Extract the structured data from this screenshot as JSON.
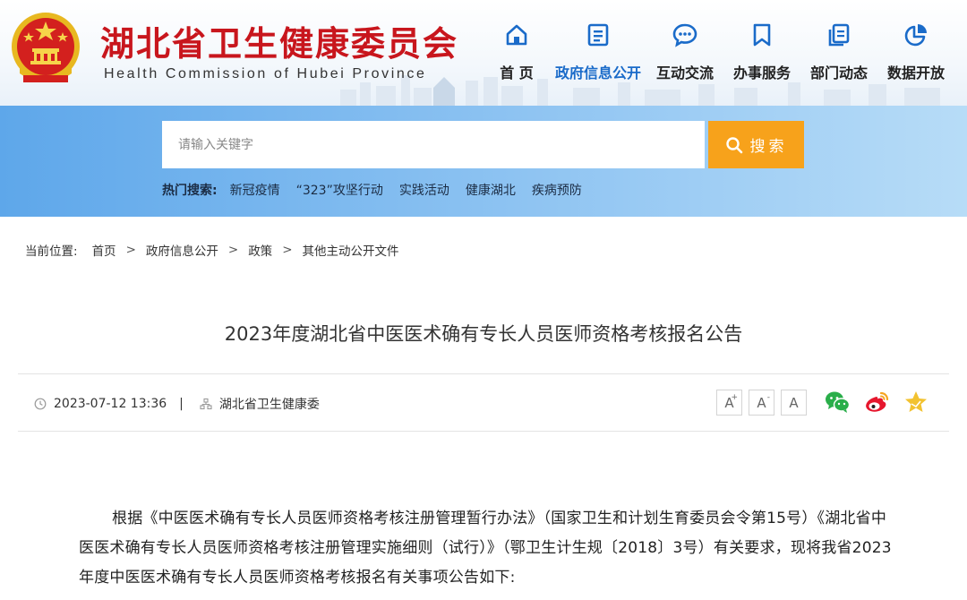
{
  "header": {
    "title": "湖北省卫生健康委员会",
    "subtitle": "Health Commission of Hubei Province",
    "brand_color": "#c8161d"
  },
  "nav": {
    "items": [
      {
        "label": "首 页",
        "icon": "home-icon",
        "active": false
      },
      {
        "label": "政府信息公开",
        "icon": "document-list-icon",
        "active": true
      },
      {
        "label": "互动交流",
        "icon": "chat-bubble-icon",
        "active": false
      },
      {
        "label": "办事服务",
        "icon": "bookmark-icon",
        "active": false
      },
      {
        "label": "部门动态",
        "icon": "news-copy-icon",
        "active": false
      },
      {
        "label": "数据开放",
        "icon": "pie-chart-icon",
        "active": false
      }
    ],
    "active_color": "#1a6bc9"
  },
  "search": {
    "placeholder": "请输入关键字",
    "button_label": "搜索",
    "button_color": "#f7a21b"
  },
  "hot_search": {
    "title": "热门搜索:",
    "items": [
      "新冠疫情",
      "“323”攻坚行动",
      "实践活动",
      "健康湖北",
      "疾病预防"
    ]
  },
  "breadcrumb": {
    "label": "当前位置:",
    "items": [
      "首页",
      "政府信息公开",
      "政策",
      "其他主动公开文件"
    ],
    "separator": ">"
  },
  "article": {
    "title": "2023年度湖北省中医医术确有专长人员医师资格考核报名公告",
    "datetime": "2023-07-12 13:36",
    "meta_separator": "|",
    "source": "湖北省卫生健康委",
    "font_controls": [
      "A+",
      "A-",
      "A"
    ],
    "share": [
      "wechat-icon",
      "weibo-icon",
      "favorite-star-icon"
    ],
    "body": "根据《中医医术确有专长人员医师资格考核注册管理暂行办法》（国家卫生和计划生育委员会令第15号）《湖北省中医医术确有专长人员医师资格考核注册管理实施细则（试行）》（鄂卫生计生规〔2018〕3号）有关要求，现将我省2023年度中医医术确有专长人员医师资格考核报名有关事项公告如下:"
  }
}
